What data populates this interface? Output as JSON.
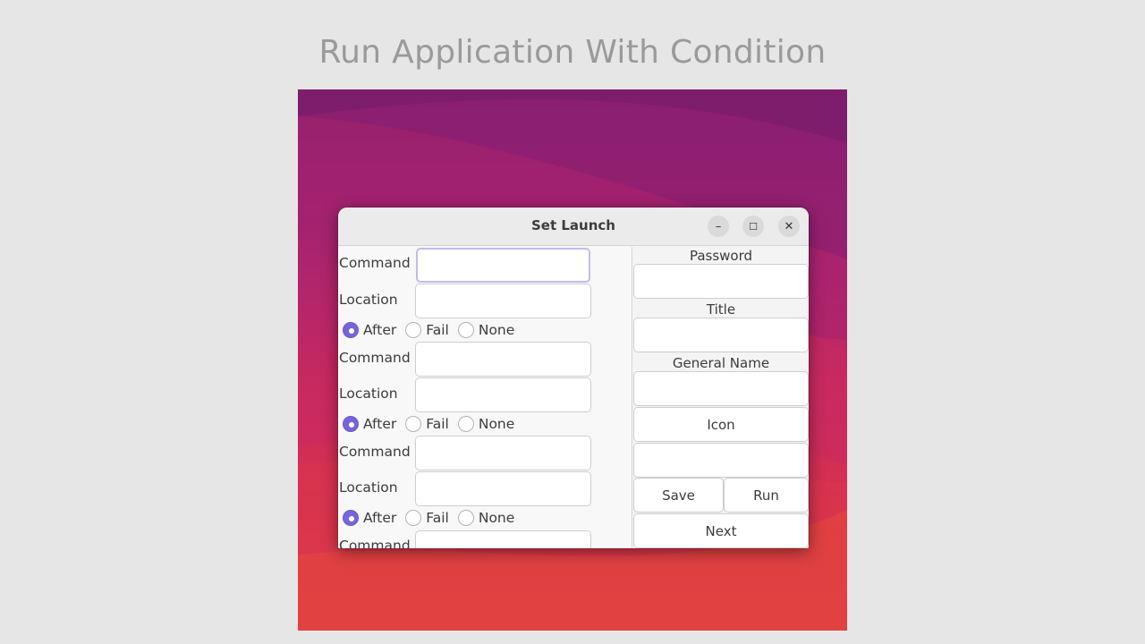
{
  "page": {
    "title": "Run Application With Condition"
  },
  "window": {
    "title": "Set Launch",
    "controls": {
      "minimize": "–",
      "maximize": "☐",
      "close": "✕"
    }
  },
  "launch_blocks": [
    {
      "command_label": "Command",
      "command_value": "",
      "location_label": "Location",
      "location_value": "",
      "options": [
        "After",
        "Fail",
        "None"
      ],
      "selected": "After"
    },
    {
      "command_label": "Command",
      "command_value": "",
      "location_label": "Location",
      "location_value": "",
      "options": [
        "After",
        "Fail",
        "None"
      ],
      "selected": "After"
    },
    {
      "command_label": "Command",
      "command_value": "",
      "location_label": "Location",
      "location_value": "",
      "options": [
        "After",
        "Fail",
        "None"
      ],
      "selected": "After"
    },
    {
      "command_label": "Command",
      "command_value": ""
    }
  ],
  "right_panel": {
    "password_label": "Password",
    "password_value": "",
    "title_label": "Title",
    "title_value": "",
    "general_name_label": "General Name",
    "general_name_value": "",
    "icon_button": "Icon",
    "icon_value": "",
    "save_button": "Save",
    "run_button": "Run",
    "next_button": "Next"
  },
  "colors": {
    "accent": "#7764d8",
    "focus_ring": "#c5b9ef"
  }
}
